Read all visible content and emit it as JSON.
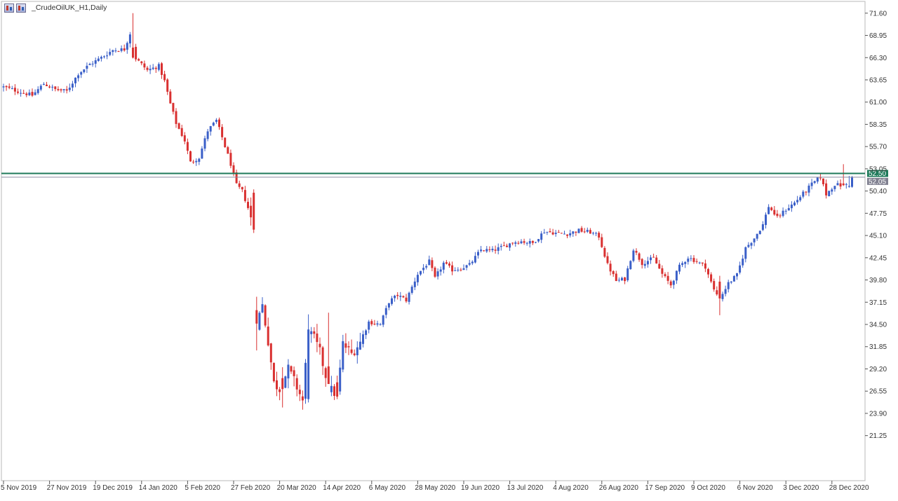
{
  "window": {
    "title": "_CrudeOilUK_H1,Daily"
  },
  "colors": {
    "bull": "#3a5fc8",
    "bear": "#d93030",
    "grid_frame": "#b8b8b8",
    "level_line": "#1e7a5a",
    "price_line": "#8a8aa0",
    "level_tag_bg": "#1e7a5a",
    "price_tag_bg": "#808090"
  },
  "chart_data": {
    "type": "candlestick",
    "title": "_CrudeOilUK_H1,Daily",
    "ylim": [
      18.55,
      72.0
    ],
    "y_ticks": [
      "71.60",
      "68.95",
      "66.30",
      "63.65",
      "61.00",
      "58.35",
      "55.70",
      "53.05",
      "50.40",
      "47.75",
      "45.10",
      "42.45",
      "39.80",
      "37.15",
      "34.50",
      "31.85",
      "29.20",
      "26.55",
      "23.90",
      "21.25"
    ],
    "x_ticks": [
      {
        "label": "5 Nov 2019",
        "bar": 0
      },
      {
        "label": "27 Nov 2019",
        "bar": 16
      },
      {
        "label": "19 Dec 2019",
        "bar": 32
      },
      {
        "label": "14 Jan 2020",
        "bar": 48
      },
      {
        "label": "5 Feb 2020",
        "bar": 64
      },
      {
        "label": "27 Feb 2020",
        "bar": 80
      },
      {
        "label": "20 Mar 2020",
        "bar": 96
      },
      {
        "label": "14 Apr 2020",
        "bar": 112
      },
      {
        "label": "6 May 2020",
        "bar": 128
      },
      {
        "label": "28 May 2020",
        "bar": 144
      },
      {
        "label": "19 Jun 2020",
        "bar": 160
      },
      {
        "label": "13 Jul 2020",
        "bar": 176
      },
      {
        "label": "4 Aug 2020",
        "bar": 192
      },
      {
        "label": "26 Aug 2020",
        "bar": 208
      },
      {
        "label": "17 Sep 2020",
        "bar": 224
      },
      {
        "label": "9 Oct 2020",
        "bar": 240
      },
      {
        "label": "6 Nov 2020",
        "bar": 256
      },
      {
        "label": "3 Dec 2020",
        "bar": 272
      },
      {
        "label": "28 Dec 2020",
        "bar": 288
      }
    ],
    "close_path": [
      [
        0,
        62.8
      ],
      [
        6,
        62.2
      ],
      [
        10,
        61.8
      ],
      [
        14,
        63.2
      ],
      [
        18,
        62.5
      ],
      [
        22,
        62.3
      ],
      [
        26,
        64.4
      ],
      [
        30,
        65.5
      ],
      [
        34,
        66.3
      ],
      [
        38,
        67.2
      ],
      [
        42,
        67.3
      ],
      [
        44,
        69.2
      ],
      [
        46,
        66.2
      ],
      [
        50,
        64.8
      ],
      [
        54,
        65.3
      ],
      [
        56,
        63.5
      ],
      [
        58,
        60.8
      ],
      [
        60,
        58.5
      ],
      [
        63,
        56.4
      ],
      [
        65,
        53.8
      ],
      [
        68,
        54.4
      ],
      [
        71,
        57.6
      ],
      [
        74,
        58.8
      ],
      [
        76,
        56.8
      ],
      [
        79,
        53.6
      ],
      [
        81,
        51.1
      ],
      [
        83,
        50.4
      ],
      [
        85,
        48.4
      ],
      [
        87,
        45.8
      ],
      [
        88,
        34.6
      ],
      [
        90,
        36.8
      ],
      [
        92,
        32.5
      ],
      [
        94,
        27.5
      ],
      [
        96,
        26.8
      ],
      [
        99,
        29.2
      ],
      [
        101,
        27.8
      ],
      [
        104,
        25.4
      ],
      [
        106,
        33.8
      ],
      [
        108,
        32.8
      ],
      [
        110,
        31.2
      ],
      [
        113,
        27.0
      ],
      [
        116,
        26.0
      ],
      [
        118,
        32.2
      ],
      [
        121,
        31.0
      ],
      [
        124,
        32.4
      ],
      [
        127,
        34.8
      ],
      [
        131,
        34.5
      ],
      [
        134,
        37.2
      ],
      [
        137,
        38.0
      ],
      [
        140,
        37.4
      ],
      [
        144,
        40.5
      ],
      [
        148,
        42.0
      ],
      [
        150,
        40.0
      ],
      [
        153,
        41.8
      ],
      [
        156,
        41.0
      ],
      [
        159,
        41.2
      ],
      [
        162,
        41.6
      ],
      [
        166,
        43.4
      ],
      [
        170,
        43.3
      ],
      [
        174,
        43.8
      ],
      [
        177,
        44.3
      ],
      [
        180,
        44.4
      ],
      [
        184,
        44.2
      ],
      [
        188,
        45.6
      ],
      [
        192,
        45.4
      ],
      [
        196,
        45.3
      ],
      [
        200,
        45.7
      ],
      [
        204,
        45.5
      ],
      [
        207,
        45.0
      ],
      [
        210,
        41.6
      ],
      [
        213,
        39.7
      ],
      [
        216,
        39.9
      ],
      [
        219,
        43.5
      ],
      [
        222,
        41.8
      ],
      [
        226,
        42.4
      ],
      [
        229,
        40.5
      ],
      [
        232,
        39.2
      ],
      [
        235,
        41.4
      ],
      [
        238,
        42.5
      ],
      [
        241,
        42.0
      ],
      [
        244,
        41.4
      ],
      [
        247,
        38.6
      ],
      [
        249,
        37.6
      ],
      [
        252,
        39.4
      ],
      [
        255,
        40.4
      ],
      [
        258,
        43.6
      ],
      [
        261,
        44.8
      ],
      [
        264,
        46.4
      ],
      [
        266,
        48.6
      ],
      [
        269,
        47.2
      ],
      [
        272,
        48.2
      ],
      [
        275,
        49.0
      ],
      [
        278,
        50.1
      ],
      [
        281,
        51.2
      ],
      [
        284,
        52.1
      ],
      [
        286,
        50.0
      ],
      [
        289,
        51.2
      ],
      [
        292,
        51.0
      ],
      [
        294,
        51.4
      ],
      [
        295,
        52.0
      ]
    ],
    "pinned_candles": [
      {
        "bar": 45,
        "open": 67.5,
        "high": 71.6,
        "low": 66.2,
        "close": 66.3
      },
      {
        "bar": 87,
        "open": 50.2,
        "high": 50.6,
        "low": 45.4,
        "close": 45.8
      },
      {
        "bar": 88,
        "open": 36.2,
        "high": 37.8,
        "low": 31.4,
        "close": 34.6
      },
      {
        "bar": 97,
        "open": 28.1,
        "high": 29.4,
        "low": 24.6,
        "close": 26.8
      },
      {
        "bar": 106,
        "open": 25.6,
        "high": 35.7,
        "low": 25.2,
        "close": 33.9
      },
      {
        "bar": 113,
        "open": 29.5,
        "high": 35.9,
        "low": 28.8,
        "close": 27.4
      },
      {
        "bar": 116,
        "open": 27.6,
        "high": 28.4,
        "low": 25.6,
        "close": 25.9
      },
      {
        "bar": 249,
        "open": 39.6,
        "high": 40.3,
        "low": 35.6,
        "close": 37.6
      },
      {
        "bar": 292,
        "open": 51.3,
        "high": 53.6,
        "low": 51.0,
        "close": 51.1
      },
      {
        "bar": 294,
        "open": 50.9,
        "high": 52.2,
        "low": 50.8,
        "close": 51.0
      },
      {
        "bar": 295,
        "open": 50.9,
        "high": 52.2,
        "low": 50.8,
        "close": 52.05
      }
    ],
    "horizontal_levels": [
      {
        "label": "52.50",
        "value": 52.5,
        "kind": "level"
      },
      {
        "label": "52.05",
        "value": 52.05,
        "kind": "price"
      }
    ]
  }
}
